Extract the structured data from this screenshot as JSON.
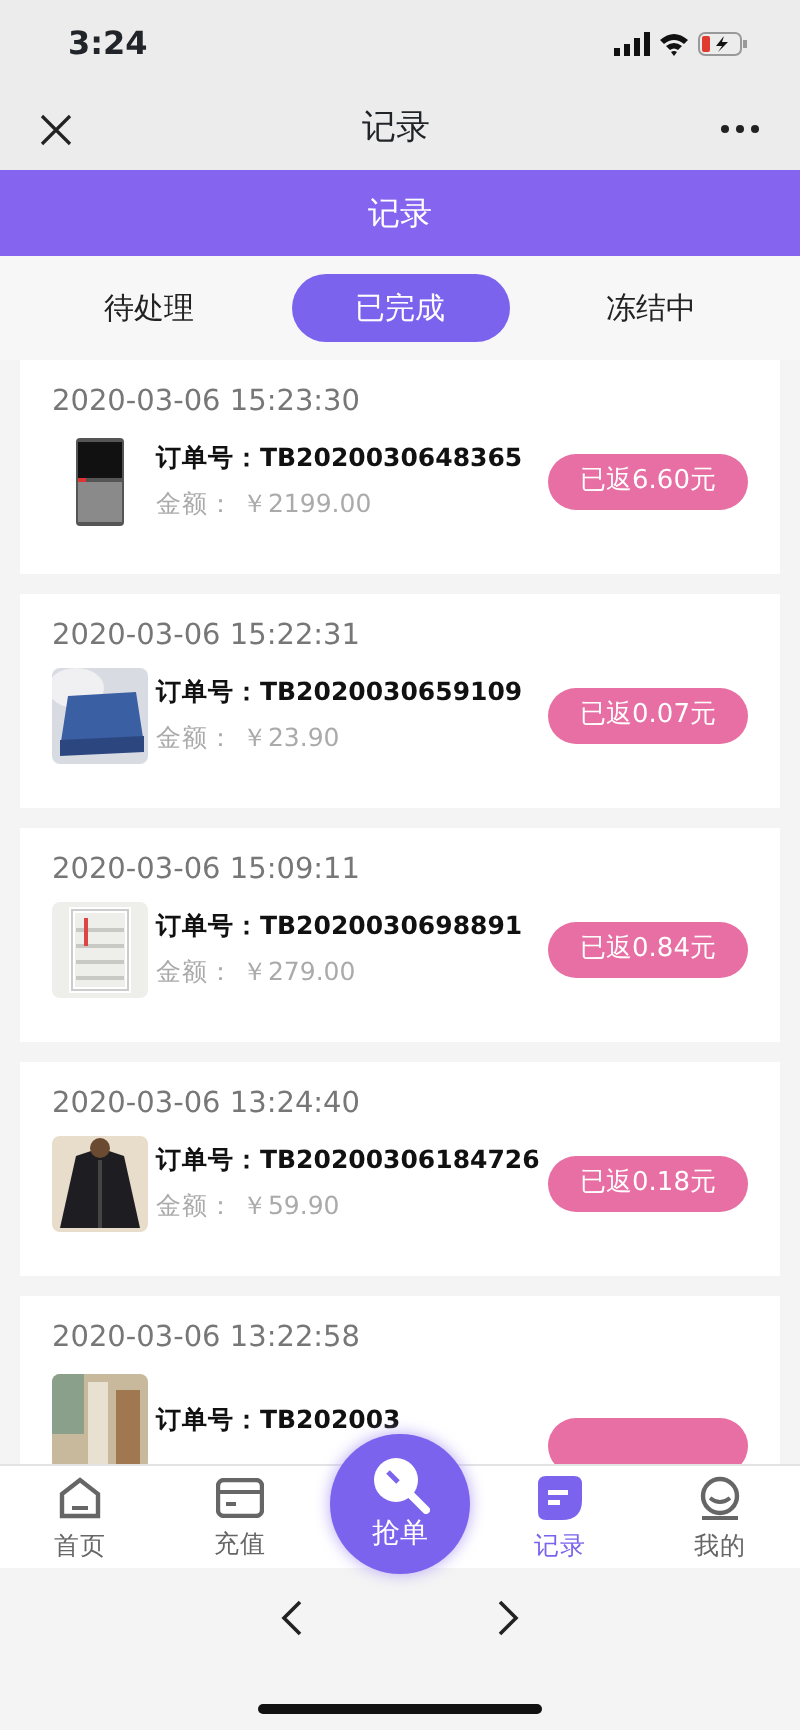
{
  "status_bar": {
    "time": "3:24"
  },
  "nav_bar": {
    "title": "记录"
  },
  "header": {
    "title": "记录"
  },
  "tabs": [
    {
      "label": "待处理",
      "selected": false
    },
    {
      "label": "已完成",
      "selected": true
    },
    {
      "label": "冻结中",
      "selected": false
    }
  ],
  "records": [
    {
      "time": "2020-03-06 15:23:30",
      "order": "订单号：TB2020030648365",
      "amount": "金额： ￥2199.00",
      "rebate": "已返6.60元"
    },
    {
      "time": "2020-03-06 15:22:31",
      "order": "订单号：TB2020030659109",
      "amount": "金额： ￥23.90",
      "rebate": "已返0.07元"
    },
    {
      "time": "2020-03-06 15:09:11",
      "order": "订单号：TB2020030698891",
      "amount": "金额： ￥279.00",
      "rebate": "已返0.84元"
    },
    {
      "time": "2020-03-06 13:24:40",
      "order": "订单号：TB20200306184726",
      "amount": "金额： ￥59.90",
      "rebate": "已返0.18元"
    },
    {
      "time": "2020-03-06 13:22:58",
      "order": "订单号：TB202003"
    }
  ],
  "bottom_nav": [
    {
      "label": "首页",
      "kind": "home",
      "selected": false
    },
    {
      "label": "充值",
      "kind": "card",
      "selected": false
    },
    {
      "label": "抢单",
      "kind": "grab"
    },
    {
      "label": "记录",
      "kind": "record",
      "selected": true
    },
    {
      "label": "我的",
      "kind": "me",
      "selected": false
    }
  ]
}
